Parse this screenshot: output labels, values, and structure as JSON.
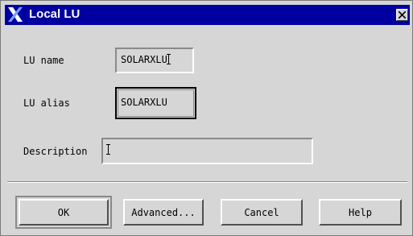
{
  "window": {
    "title": "Local LU",
    "title_icon": "x-logo-icon",
    "close_icon": "close-icon"
  },
  "form": {
    "lu_name_label": "LU name",
    "lu_name_value": "SOLARXLU",
    "lu_alias_label": "LU alias",
    "lu_alias_value": "SOLARXLU",
    "description_label": "Description",
    "description_value": ""
  },
  "buttons": {
    "ok": "OK",
    "advanced": "Advanced...",
    "cancel": "Cancel",
    "help": "Help"
  },
  "colors": {
    "titlebar": "#0000a0",
    "face": "#d6d6d6"
  }
}
